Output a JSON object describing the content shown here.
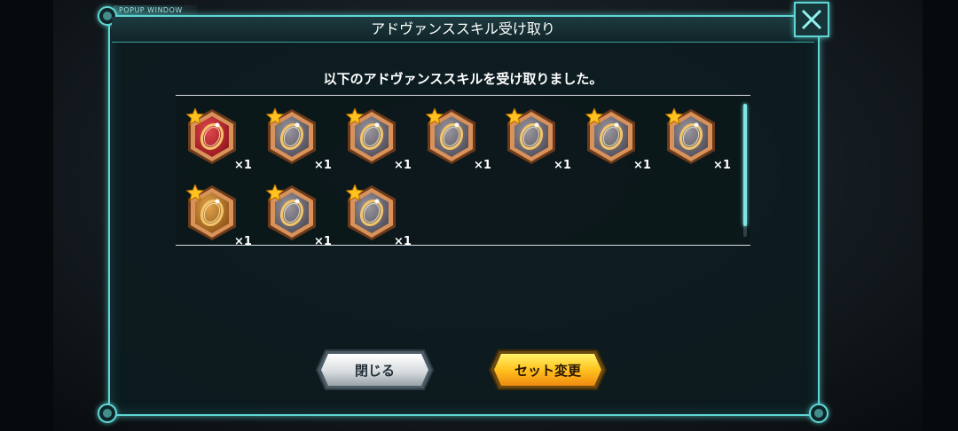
{
  "popup": {
    "tag": "POPUP WINDOW",
    "title": "アドヴァンススキル受け取り",
    "message": "以下のアドヴァンススキルを受け取りました。"
  },
  "items": [
    {
      "name": "red-ring-skill",
      "qty": "×1",
      "rarity": "red"
    },
    {
      "name": "silver-ring-skill",
      "qty": "×1",
      "rarity": "silver"
    },
    {
      "name": "silver-ring-skill",
      "qty": "×1",
      "rarity": "silver"
    },
    {
      "name": "silver-ring-skill",
      "qty": "×1",
      "rarity": "silver"
    },
    {
      "name": "silver-ring-skill",
      "qty": "×1",
      "rarity": "silver"
    },
    {
      "name": "silver-ring-skill",
      "qty": "×1",
      "rarity": "silver"
    },
    {
      "name": "silver-ring-skill",
      "qty": "×1",
      "rarity": "silver"
    },
    {
      "name": "bronze-ring-skill",
      "qty": "×1",
      "rarity": "bronze"
    },
    {
      "name": "silver-ring-skill",
      "qty": "×1",
      "rarity": "silver"
    },
    {
      "name": "silver-ring-skill",
      "qty": "×1",
      "rarity": "silver"
    }
  ],
  "buttons": {
    "close_label": "閉じる",
    "set_change_label": "セット変更"
  },
  "colors": {
    "frame": "#5fd6d4",
    "red_medal": "#b0232a",
    "silver_medal": "#6f6a72",
    "bronze_medal": "#b8741e",
    "gold_button": "#f4a81a"
  },
  "icons": {
    "close": "close-x-icon",
    "star": "star-icon",
    "ring": "ring-icon"
  }
}
